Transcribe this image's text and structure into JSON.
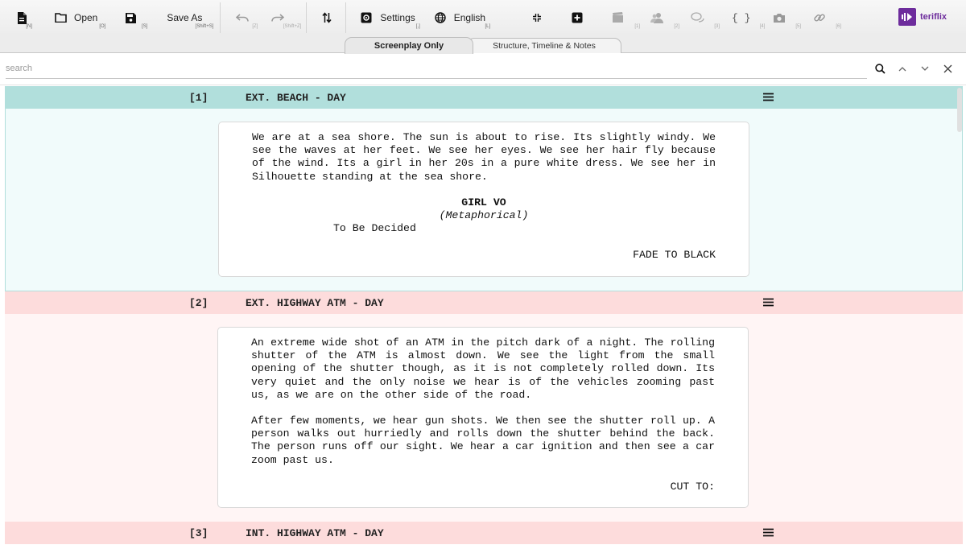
{
  "toolbar": {
    "new": {
      "label": "",
      "shortcut": "[N]",
      "icon": "new-document-icon"
    },
    "open": {
      "label": "Open",
      "shortcut": "[O]",
      "icon": "folder-icon"
    },
    "save": {
      "label": "",
      "shortcut": "[S]",
      "icon": "save-icon"
    },
    "save_as": {
      "label": "Save As",
      "shortcut": "[Shift+S]"
    },
    "undo": {
      "label": "",
      "shortcut": "[Z]",
      "icon": "undo-icon"
    },
    "redo": {
      "label": "",
      "shortcut": "[Shift+Z]",
      "icon": "redo-icon"
    },
    "sort": {
      "label": "",
      "icon": "sort-arrows-icon"
    },
    "settings": {
      "label": "Settings",
      "shortcut": "[,]",
      "icon": "gear-icon"
    },
    "language": {
      "label": "English",
      "shortcut": "[L]",
      "icon": "globe-icon"
    },
    "collapse": {
      "icon": "collapse-icon"
    },
    "add": {
      "icon": "add-box-icon"
    },
    "slots": [
      {
        "icon": "clapperboard-icon",
        "shortcut": "[1]"
      },
      {
        "icon": "characters-icon",
        "shortcut": "[2]"
      },
      {
        "icon": "speech-bubbles-icon",
        "shortcut": "[3]"
      },
      {
        "icon": "braces-icon",
        "shortcut": "[4]"
      },
      {
        "icon": "camera-icon",
        "shortcut": "[5]"
      },
      {
        "icon": "link-icon",
        "shortcut": "[6]"
      }
    ],
    "braces_text": "{ }",
    "logo_text": "teriflix"
  },
  "tabs": [
    {
      "label": "Screenplay Only",
      "active": true
    },
    {
      "label": "Structure, Timeline & Notes",
      "active": false
    }
  ],
  "search": {
    "placeholder": "search",
    "value": ""
  },
  "scenes": [
    {
      "number": "[1]",
      "heading": "EXT. BEACH - DAY",
      "color": "#b1dfdc",
      "action": "We are at a sea shore. The sun is about to rise. Its slightly windy. We see the waves at her feet. We see her eyes. We see her hair fly because of the wind. Its a girl in her 20s in a pure white dress. We see her in Silhouette standing at the sea shore.",
      "character": "GIRL VO",
      "parenthetical": "(Metaphorical)",
      "dialogue": "To Be Decided",
      "transition": "FADE TO BLACK"
    },
    {
      "number": "[2]",
      "heading": "EXT. HIGHWAY ATM - DAY",
      "color": "#fddcdc",
      "action": "An extreme wide shot of an ATM in the pitch dark of a night. The rolling shutter of the ATM is almost down. We see the light from the small opening of the shutter though, as it is not completely rolled down. Its very quiet and the only noise we hear is of the vehicles zooming past us, as we are on the other side of the road.",
      "action2": "After few moments, we hear gun shots. We then see the shutter roll up. A person walks out hurriedly and rolls down the shutter behind the back. The person runs off our sight. We hear a car ignition and then see a car zoom past us.",
      "transition": "CUT TO:"
    },
    {
      "number": "[3]",
      "heading": "INT. HIGHWAY ATM - DAY",
      "color": "#fddcdc"
    }
  ]
}
